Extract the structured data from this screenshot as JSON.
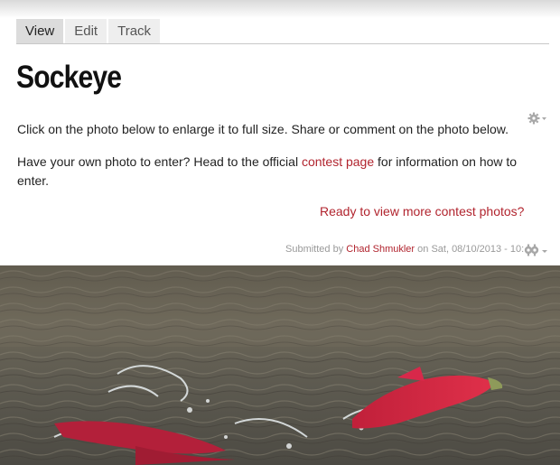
{
  "tabs": [
    {
      "label": "View",
      "active": true
    },
    {
      "label": "Edit",
      "active": false
    },
    {
      "label": "Track",
      "active": false
    }
  ],
  "page_title": "Sockeye",
  "intro_text": "Click on the photo below to enlarge it to full size. Share or comment on the photo below.",
  "enter_text_before": "Have your own photo to enter? Head to the official ",
  "contest_link": "contest page",
  "enter_text_after": " for information on how to enter.",
  "more_photos_link": "Ready to view more contest photos?",
  "submitted": {
    "prefix": "Submitted by ",
    "author": "Chad Shmukler",
    "date": " on Sat, 08/10/2013 - 10:"
  },
  "icons": [
    "gear-icon",
    "dropdown-arrow-icon"
  ],
  "colors": {
    "link": "#b1242e",
    "tab_active": "#dcdcdc",
    "tab": "#eeeeee"
  }
}
